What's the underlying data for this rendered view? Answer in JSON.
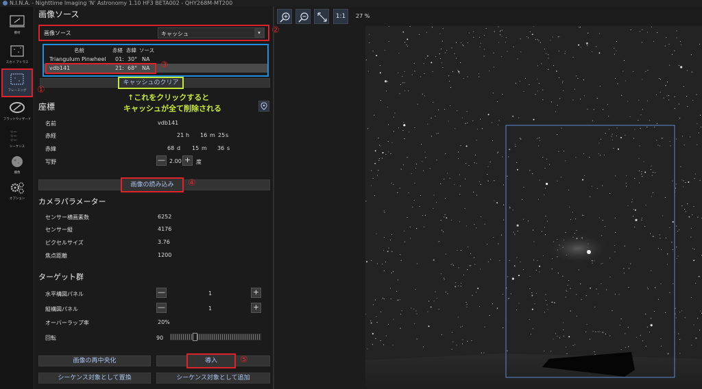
{
  "window": {
    "title": "N.I.N.A. - Nighttime Imaging 'N' Astronomy 1.10 HF3 BETA002  -  QHY268M-MT200"
  },
  "sidebar": {
    "items": [
      {
        "label": "機材",
        "icon": "telescope-icon"
      },
      {
        "label": "スカイ アトラス",
        "icon": "sky-atlas-icon"
      },
      {
        "label": "フレーミング",
        "icon": "framing-icon",
        "active": true
      },
      {
        "label": "フラットウィザード",
        "icon": "flat-wizard-icon"
      },
      {
        "label": "シーケンス",
        "icon": "sequence-icon"
      },
      {
        "label": "撮像",
        "icon": "imaging-icon"
      },
      {
        "label": "オプション",
        "icon": "gear-icon"
      }
    ]
  },
  "image_source": {
    "title": "画像ソース",
    "label": "画像ソース",
    "selected": "キャッシュ",
    "cache_table": {
      "headers": [
        "名前",
        "赤経",
        "赤緯",
        "ソース"
      ],
      "rows": [
        [
          "Triangulum Pinwheel",
          "01:",
          "30°",
          "NA"
        ],
        [
          "vdb141",
          "21:",
          "68°",
          "NA"
        ]
      ]
    },
    "clear_cache_button": "キャッシュのクリア"
  },
  "annotations": {
    "n1": "①",
    "n2": "②",
    "n3": "③",
    "n4": "④",
    "n5": "⑤",
    "note_line1": "↑これをクリックすると",
    "note_line2": "キャッシュが全て削除される",
    "note_color": "#c6e83a",
    "marker_color": "#e0232a",
    "table_frame_color": "#1e90e0"
  },
  "coordinates": {
    "title": "座標",
    "name_label": "名前",
    "name_value": "vdb141",
    "ra_label": "赤経",
    "ra_h": "21",
    "ra_h_unit": "h",
    "ra_m": "16",
    "ra_m_unit": "m",
    "ra_s": "25",
    "ra_s_unit": "s",
    "dec_label": "赤緯",
    "dec_d": "68",
    "dec_d_unit": "d",
    "dec_m": "15",
    "dec_m_unit": "m",
    "dec_s": "36",
    "dec_s_unit": "s",
    "fov_label": "写野",
    "fov_value": "2.00",
    "fov_unit": "度",
    "load_image_button": "画像の読み込み"
  },
  "camera": {
    "title": "カメラパラメーター",
    "width_label": "センサー横画素数",
    "width_value": "6252",
    "height_label": "センサー縦",
    "height_value": "4176",
    "pixel_label": "ピクセルサイズ",
    "pixel_value": "3.76",
    "focal_label": "焦点距離",
    "focal_value": "1200"
  },
  "targets": {
    "title": "ターゲット群",
    "hpanels_label": "水平構図パネル",
    "hpanels_value": "1",
    "vpanels_label": "縦構図パネル",
    "vpanels_value": "1",
    "overlap_label": "オーバーラップ率",
    "overlap_value": "20%",
    "rotation_label": "回転",
    "rotation_value": "90"
  },
  "buttons": {
    "recenter": "画像の再中央化",
    "import": "導入",
    "replace_sequence": "シーケンス対象として置換",
    "add_sequence": "シーケンス対象として追加"
  },
  "toolbar": {
    "zoom_in": "zoom-in-icon",
    "zoom_out": "zoom-out-icon",
    "fit": "fit-icon",
    "one_to_one": "1:1",
    "zoom_level": "27 %"
  },
  "colors": {
    "accent_text": "#aac4f0",
    "frame_rect": "#5b8bd6"
  }
}
